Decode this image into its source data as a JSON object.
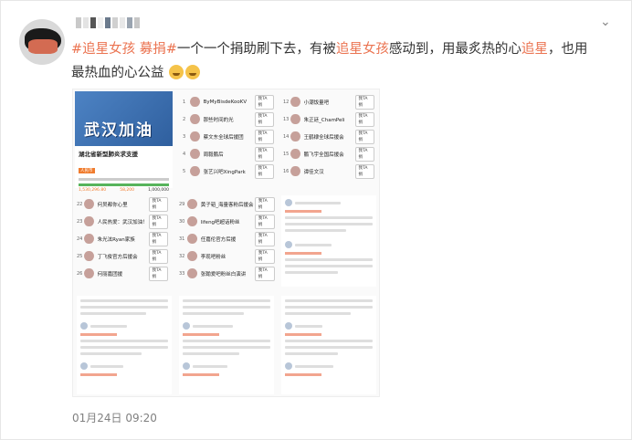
{
  "post": {
    "hashtag": "#追星女孩 募捐#",
    "segments": [
      {
        "text": "#追星女孩 募捐#",
        "highlight": true
      },
      {
        "text": "一个一个捐助刷下去，有被",
        "highlight": false
      },
      {
        "text": "追星女孩",
        "highlight": true
      },
      {
        "text": "感动到，用最炙热的心",
        "highlight": false
      },
      {
        "text": "追星",
        "highlight": true
      },
      {
        "text": "，也用最热血的心公益",
        "highlight": false
      }
    ],
    "emojis": [
      "crying-face-emoji",
      "crying-face-emoji"
    ],
    "timestamp": "01月24日 09:20"
  },
  "screenshot": {
    "banner_text": "武汉加油",
    "project_title": "湖北省新型肺炎求支援",
    "project_badge": "人民币",
    "project_progress": 1.0,
    "project_stats": [
      "1,530,296.80",
      "58,200",
      "1,000,000"
    ],
    "leaderboard_left": [
      {
        "rank": "1",
        "name": "ByMyBisdeKooKV",
        "btn": "我TA捐"
      },
      {
        "rank": "2",
        "name": "那些时间的光",
        "btn": "我TA捐"
      },
      {
        "rank": "3",
        "name": "蔡文东全球后援团",
        "btn": "我TA捐"
      },
      {
        "rank": "4",
        "name": "周毅鹏后",
        "btn": "我TA捐"
      },
      {
        "rank": "5",
        "name": "张艺兴吧XingPark",
        "btn": "我TA捐"
      }
    ],
    "leaderboard_right": [
      {
        "rank": "12",
        "name": "小潮饭量吧",
        "btn": "我TA捐"
      },
      {
        "rank": "13",
        "name": "朱正廷_ChamPeli",
        "btn": "我TA捐"
      },
      {
        "rank": "14",
        "name": "王鹤棣全球后援会",
        "btn": "我TA捐"
      },
      {
        "rank": "15",
        "name": "鹏飞宇全国后援会",
        "btn": "我TA捐"
      },
      {
        "rank": "16",
        "name": "谭佳文汉",
        "btn": "我TA捐"
      }
    ],
    "leaderboard_mid_a": [
      {
        "rank": "22",
        "name": "何炅都你心里",
        "btn": "我TA捐"
      },
      {
        "rank": "23",
        "name": "人民热爱：武汉加油！",
        "btn": "我TA捐"
      },
      {
        "rank": "24",
        "name": "朱光泫Ryan家族",
        "btn": "我TA捐"
      },
      {
        "rank": "25",
        "name": "丁飞俊官方后援会",
        "btn": "我TA捐"
      },
      {
        "rank": "26",
        "name": "何丽嘉团援",
        "btn": "我TA捐"
      }
    ],
    "leaderboard_mid_b": [
      {
        "rank": "29",
        "name": "黄子韬_海量客粉后援会",
        "btn": "我TA捐"
      },
      {
        "rank": "30",
        "name": "lifeng吧超话粉丝",
        "btn": "我TA捐"
      },
      {
        "rank": "31",
        "name": "任嘉伦官方后援",
        "btn": "我TA捐"
      },
      {
        "rank": "32",
        "name": "李现吧粉丝",
        "btn": "我TA捐"
      },
      {
        "rank": "33",
        "name": "张翰爱吧粉丝白演讲",
        "btn": "我TA捐"
      }
    ]
  }
}
